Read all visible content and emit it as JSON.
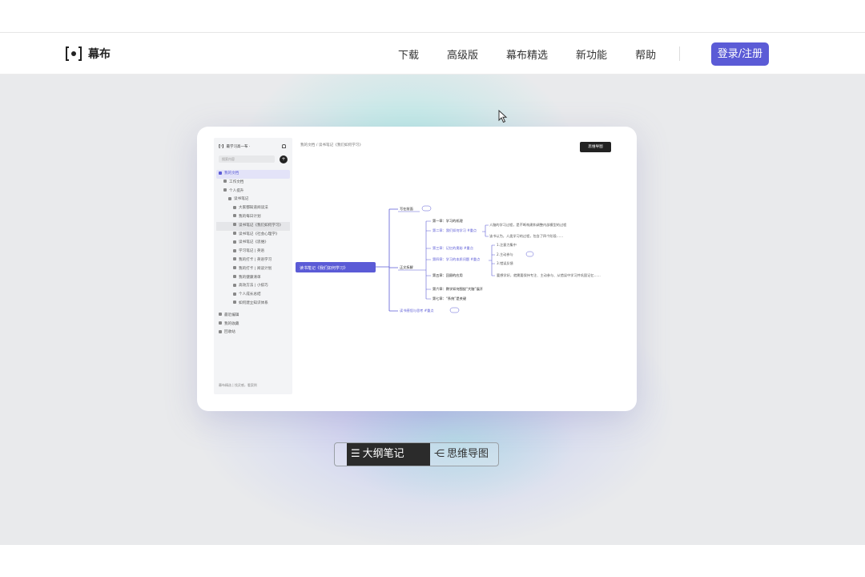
{
  "brand": {
    "name": "幕布"
  },
  "nav": {
    "items": [
      "下载",
      "高级版",
      "幕布精选",
      "新功能",
      "帮助"
    ],
    "login_label": "登录/注册"
  },
  "preview": {
    "sidebar": {
      "title": "最学习高一布 ·",
      "search_placeholder": "搜索内容",
      "items": [
        {
          "label": "我的文档",
          "state": "active"
        },
        {
          "label": "工作文档",
          "state": ""
        },
        {
          "label": "个人提升",
          "state": ""
        },
        {
          "label": "读书笔记",
          "state": ""
        },
        {
          "label": "大家都知道阅读法",
          "state": ""
        },
        {
          "label": "我的每日计划",
          "state": ""
        },
        {
          "label": "读书笔记《我们如何学习》",
          "state": "sel"
        },
        {
          "label": "读书笔记《社会心理学》",
          "state": ""
        },
        {
          "label": "读书笔记《思维》",
          "state": ""
        },
        {
          "label": "学习笔记 | 英语",
          "state": ""
        },
        {
          "label": "我的打卡 | 英语学习",
          "state": ""
        },
        {
          "label": "我的打卡 | 阅读计划",
          "state": ""
        },
        {
          "label": "我的健康清单",
          "state": ""
        },
        {
          "label": "高效方法 | 小技巧",
          "state": ""
        },
        {
          "label": "个人成长总结",
          "state": ""
        },
        {
          "label": "如何建立知识体系",
          "state": ""
        },
        {
          "label": "最近编辑",
          "state": ""
        },
        {
          "label": "我的收藏",
          "state": ""
        },
        {
          "label": "回收站",
          "state": ""
        }
      ],
      "footer": "幕布精选 | 找灵感，看案例"
    },
    "breadcrumb": "我的文档 / 读书笔记《我们如何学习》",
    "mindmap_button": "思维导图",
    "mindmap": {
      "root": "读书笔记《我们如何学习》",
      "branches": [
        "写在前面",
        "正文拆解",
        "读书感悟与思考 #重点"
      ],
      "sub": [
        "第一章：学习的机理",
        "第二章：我们如何学习 #重点",
        "第三章：记忆的奥秘 #重点",
        "第四章：学习的本质问题 #重点",
        "第五章：回顾的应用",
        "第六章：教学如何围绕“大脑”展开",
        "第七章：“系统”是关键"
      ],
      "notes": [
        "人脑的学习过程，是不断构建和调整内部模型的过程",
        "该书认为，人类学习的过程，包含了四个阶段……",
        "1.注意力集中",
        "2.主动参与",
        "3.错误反馈",
        "要想学好，就需要保持专注、主动参与、从错误中学习并巩固记忆……"
      ]
    }
  },
  "toggle": {
    "outline_label": "大纲笔记",
    "mindmap_label": "思维导图",
    "active": "outline"
  },
  "colors": {
    "accent": "#5b5bd6",
    "dark": "#2b2b2b"
  }
}
